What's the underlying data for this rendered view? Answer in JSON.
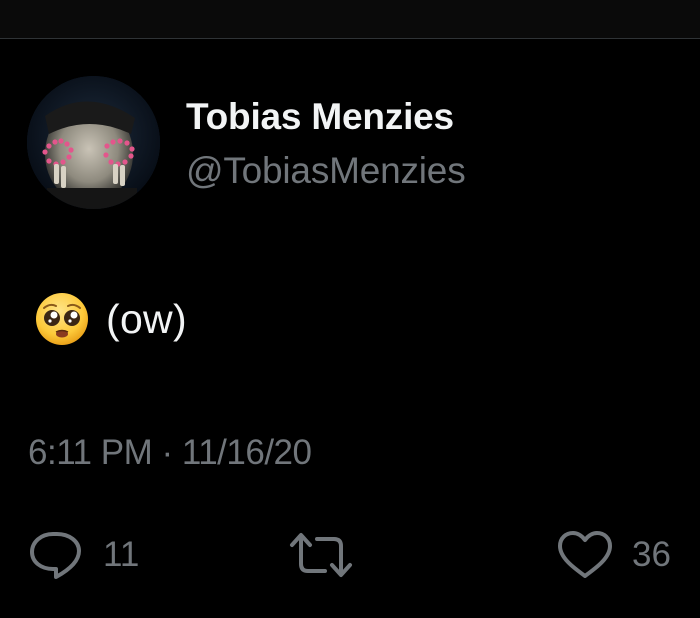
{
  "tweet": {
    "author": {
      "name": "Tobias Menzies",
      "handle": "@TobiasMenzies"
    },
    "body": {
      "emoji": "pleading-face-emoji",
      "text": "(ow)"
    },
    "timestamp": "6:11 PM · 11/16/20",
    "actions": {
      "reply": {
        "icon": "reply-icon",
        "count": "11"
      },
      "retweet": {
        "icon": "retweet-icon",
        "count": ""
      },
      "like": {
        "icon": "heart-icon",
        "count": "36"
      }
    }
  },
  "colors": {
    "background": "#000000",
    "primary_text": "#f2f4f5",
    "secondary_text": "#71767b"
  }
}
